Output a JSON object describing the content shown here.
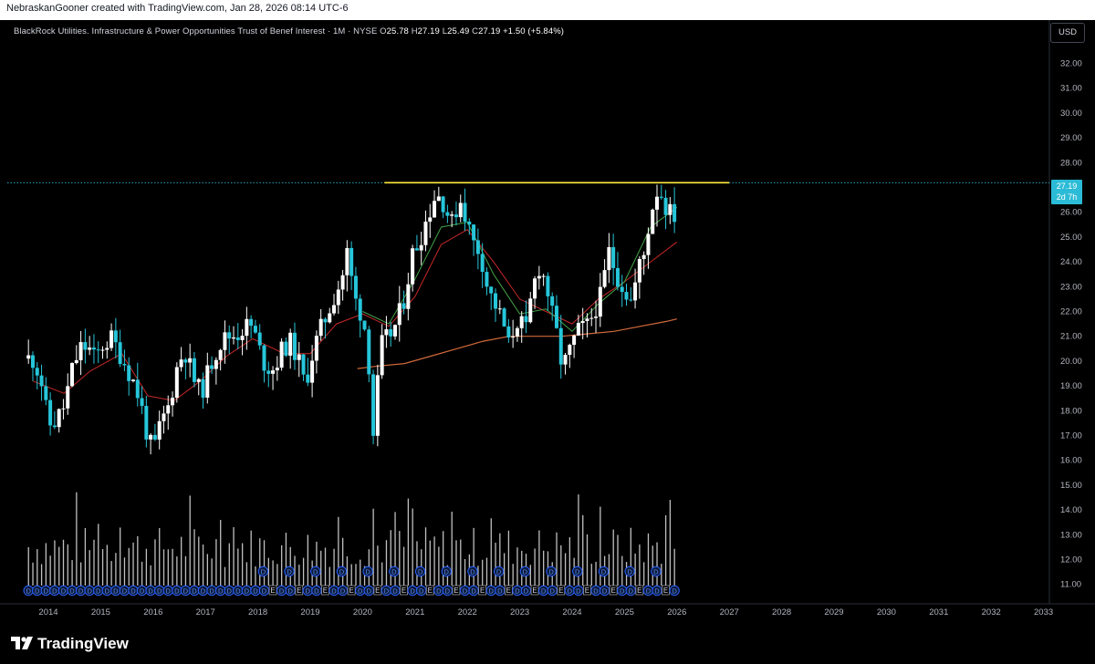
{
  "attribution": "NebraskanGooner created with TradingView.com, Jan 28, 2026 08:14 UTC-6",
  "legend": {
    "symbol_name": "BlackRock Utilities. Infrastructure & Power Opportunities Trust of Benef Interest · 1M · NYSE",
    "open_key": "O",
    "open": "25.78",
    "high_key": "H",
    "high": "27.19",
    "low_key": "L",
    "low": "25.49",
    "close_key": "C",
    "close": "27.19",
    "change": "+1.50 (+5.84%)"
  },
  "currency_button": "USD",
  "price_badge": {
    "price": "27.19",
    "countdown": "2d 7h"
  },
  "brand": "TradingView",
  "colors": {
    "background": "#000000",
    "up_candle": "#ffffff",
    "down_candle": "#26c6da",
    "volume": "#ffffff",
    "resistance_line": "#ffeb3b",
    "ma_short": "#43a047",
    "ma_mid": "#c62828",
    "ma_long": "#d26a3a",
    "last_price": "#2bbbd6"
  },
  "chart_data": {
    "type": "candlestick",
    "timeframe": "1M",
    "y_ticks": [
      "32.00",
      "31.00",
      "30.00",
      "29.00",
      "28.00",
      "27.00",
      "26.00",
      "25.00",
      "24.00",
      "23.00",
      "22.00",
      "21.00",
      "20.00",
      "19.00",
      "18.00",
      "17.00",
      "16.00",
      "15.00",
      "14.00",
      "13.00",
      "12.00",
      "11.00"
    ],
    "x_ticks": [
      "2014",
      "2015",
      "2016",
      "2017",
      "2018",
      "2019",
      "2020",
      "2021",
      "2022",
      "2023",
      "2024",
      "2025",
      "2026",
      "2027",
      "2028",
      "2029",
      "2030",
      "2031",
      "2032",
      "2033"
    ],
    "x_range": [
      "2013-06",
      "2033-02"
    ],
    "y_range": [
      11,
      32.5
    ],
    "close_path": [
      [
        2013.7,
        20.1
      ],
      [
        2013.85,
        19.4
      ],
      [
        2014.0,
        17.4
      ],
      [
        2014.15,
        17.6
      ],
      [
        2014.3,
        18.2
      ],
      [
        2014.45,
        19.6
      ],
      [
        2014.6,
        20.5
      ],
      [
        2014.75,
        20.6
      ],
      [
        2014.9,
        20.0
      ],
      [
        2015.0,
        20.6
      ],
      [
        2015.2,
        20.9
      ],
      [
        2015.4,
        20.2
      ],
      [
        2015.6,
        19.3
      ],
      [
        2015.75,
        18.4
      ],
      [
        2015.9,
        16.9
      ],
      [
        2016.0,
        16.3
      ],
      [
        2016.15,
        17.5
      ],
      [
        2016.3,
        18.2
      ],
      [
        2016.45,
        19.7
      ],
      [
        2016.6,
        20.5
      ],
      [
        2016.75,
        19.4
      ],
      [
        2016.9,
        18.7
      ],
      [
        2017.0,
        19.2
      ],
      [
        2017.15,
        20.2
      ],
      [
        2017.3,
        20.8
      ],
      [
        2017.45,
        21.0
      ],
      [
        2017.6,
        21.1
      ],
      [
        2017.75,
        21.4
      ],
      [
        2017.9,
        21.4
      ],
      [
        2018.0,
        20.6
      ],
      [
        2018.15,
        19.8
      ],
      [
        2018.3,
        19.7
      ],
      [
        2018.45,
        20.4
      ],
      [
        2018.6,
        20.8
      ],
      [
        2018.75,
        20.2
      ],
      [
        2018.9,
        19.0
      ],
      [
        2019.0,
        20.0
      ],
      [
        2019.15,
        21.0
      ],
      [
        2019.3,
        21.8
      ],
      [
        2019.45,
        22.6
      ],
      [
        2019.6,
        23.3
      ],
      [
        2019.7,
        24.4
      ],
      [
        2019.85,
        22.5
      ],
      [
        2020.0,
        21.8
      ],
      [
        2020.1,
        20.6
      ],
      [
        2020.2,
        17.0
      ],
      [
        2020.35,
        20.6
      ],
      [
        2020.5,
        21.0
      ],
      [
        2020.65,
        21.5
      ],
      [
        2020.8,
        22.6
      ],
      [
        2020.95,
        24.3
      ],
      [
        2021.1,
        25.0
      ],
      [
        2021.25,
        25.9
      ],
      [
        2021.4,
        26.8
      ],
      [
        2021.55,
        26.4
      ],
      [
        2021.7,
        25.5
      ],
      [
        2021.85,
        26.6
      ],
      [
        2021.95,
        26.0
      ],
      [
        2022.1,
        24.8
      ],
      [
        2022.25,
        24.4
      ],
      [
        2022.4,
        22.8
      ],
      [
        2022.55,
        22.2
      ],
      [
        2022.7,
        21.4
      ],
      [
        2022.8,
        20.5
      ],
      [
        2022.9,
        21.5
      ],
      [
        2023.0,
        21.8
      ],
      [
        2023.1,
        20.9
      ],
      [
        2023.2,
        22.3
      ],
      [
        2023.35,
        23.9
      ],
      [
        2023.5,
        23.2
      ],
      [
        2023.6,
        22.0
      ],
      [
        2023.7,
        21.1
      ],
      [
        2023.8,
        19.9
      ],
      [
        2023.9,
        20.0
      ],
      [
        2024.0,
        20.7
      ],
      [
        2024.15,
        21.3
      ],
      [
        2024.3,
        21.4
      ],
      [
        2024.45,
        22.2
      ],
      [
        2024.55,
        22.6
      ],
      [
        2024.7,
        24.4
      ],
      [
        2024.85,
        23.5
      ],
      [
        2025.0,
        22.9
      ],
      [
        2025.15,
        22.3
      ],
      [
        2025.25,
        23.8
      ],
      [
        2025.35,
        24.0
      ],
      [
        2025.5,
        26.0
      ],
      [
        2025.65,
        27.1
      ],
      [
        2025.75,
        26.4
      ],
      [
        2025.85,
        26.0
      ],
      [
        2025.95,
        25.8
      ],
      [
        2026.0,
        27.19
      ]
    ],
    "resistance_level": 27.19,
    "resistance_span": [
      "2020-06",
      "2027-01"
    ],
    "last_price": 27.19,
    "ma_long_path": [
      [
        2019.9,
        19.7
      ],
      [
        2020.3,
        19.8
      ],
      [
        2020.8,
        19.9
      ],
      [
        2021.3,
        20.2
      ],
      [
        2021.8,
        20.5
      ],
      [
        2022.3,
        20.8
      ],
      [
        2022.8,
        21.0
      ],
      [
        2023.3,
        21.0
      ],
      [
        2023.8,
        21.0
      ],
      [
        2024.3,
        21.1
      ],
      [
        2024.8,
        21.2
      ],
      [
        2025.3,
        21.4
      ],
      [
        2025.8,
        21.6
      ],
      [
        2026.0,
        21.7
      ]
    ],
    "ma_mid_path": [
      [
        2013.7,
        19.2
      ],
      [
        2014.3,
        18.7
      ],
      [
        2014.8,
        19.6
      ],
      [
        2015.4,
        20.3
      ],
      [
        2015.9,
        18.6
      ],
      [
        2016.4,
        18.4
      ],
      [
        2016.9,
        19.2
      ],
      [
        2017.4,
        20.2
      ],
      [
        2017.9,
        20.9
      ],
      [
        2018.5,
        20.3
      ],
      [
        2019.0,
        20.3
      ],
      [
        2019.5,
        21.5
      ],
      [
        2020.0,
        21.9
      ],
      [
        2020.5,
        21.4
      ],
      [
        2021.0,
        22.6
      ],
      [
        2021.5,
        24.7
      ],
      [
        2022.0,
        25.3
      ],
      [
        2022.5,
        24.0
      ],
      [
        2023.0,
        22.5
      ],
      [
        2023.5,
        22.0
      ],
      [
        2024.0,
        21.5
      ],
      [
        2024.5,
        22.5
      ],
      [
        2025.0,
        23.2
      ],
      [
        2025.5,
        24.0
      ],
      [
        2026.0,
        24.8
      ]
    ],
    "ma_short_path": [
      [
        2020.0,
        22.0
      ],
      [
        2020.5,
        21.5
      ],
      [
        2021.0,
        23.3
      ],
      [
        2021.5,
        25.4
      ],
      [
        2022.0,
        25.6
      ],
      [
        2022.5,
        23.5
      ],
      [
        2023.0,
        21.9
      ],
      [
        2023.5,
        22.1
      ],
      [
        2024.0,
        21.2
      ],
      [
        2024.5,
        22.3
      ],
      [
        2025.0,
        23.2
      ],
      [
        2025.5,
        25.4
      ],
      [
        2026.0,
        26.2
      ]
    ]
  },
  "events_row": {
    "dividend_label": "D",
    "earnings_label": "E"
  }
}
